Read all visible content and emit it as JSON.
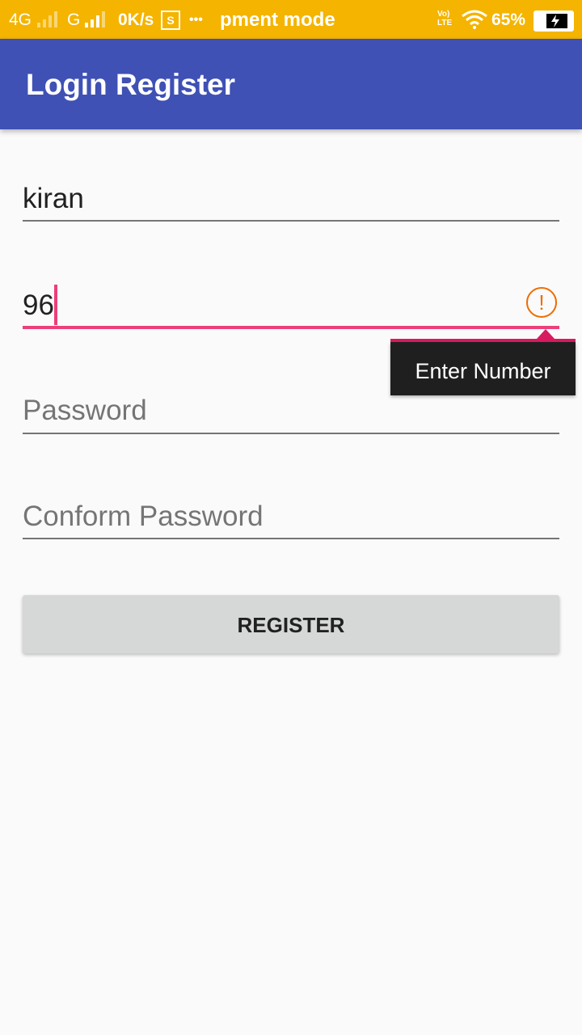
{
  "status_bar": {
    "network_1": "4G",
    "network_2": "G",
    "speed": "0K/s",
    "screenshot_icon_label": "S",
    "more": "•••",
    "notification_text": "pment mode",
    "volte": "Vo) LTE",
    "battery": "65%",
    "icons": [
      "signal-icon",
      "screenshot-icon",
      "wifi-icon",
      "battery-charging-icon"
    ]
  },
  "app_bar": {
    "title": "Login Register",
    "color": "#3f51b5"
  },
  "form": {
    "name_value": "kiran",
    "number_value": "96",
    "password_placeholder": "Password",
    "confirm_placeholder": "Conform Password",
    "error_icon_glyph": "!",
    "error_message": "Enter Number",
    "register_label": "REGISTER",
    "accent_color": "#ec407a"
  }
}
